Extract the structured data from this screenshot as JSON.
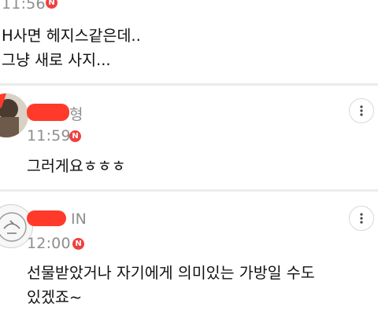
{
  "colors": {
    "background": "#ffffff",
    "divider": "#ececee",
    "timestamp": "#8e8e8e",
    "new_badge": "#f23f3f",
    "redaction": "#ff3a2a"
  },
  "comments": [
    {
      "time": "11:56",
      "new_badge": "N",
      "lines": [
        "H사면 헤지스같은데..",
        "그냥 새로 사지..."
      ]
    },
    {
      "author_suffix": "형",
      "time": "11:59",
      "new_badge": "N",
      "lines": [
        "그러게요ㅎㅎㅎ"
      ],
      "more_icon": "more-vertical-icon"
    },
    {
      "author_suffix": "IN",
      "time": "12:00",
      "new_badge": "N",
      "lines": [
        "선물받았거나 자기에게 의미있는 가방일 수도",
        "있겠죠~"
      ],
      "more_icon": "more-vertical-icon"
    }
  ]
}
